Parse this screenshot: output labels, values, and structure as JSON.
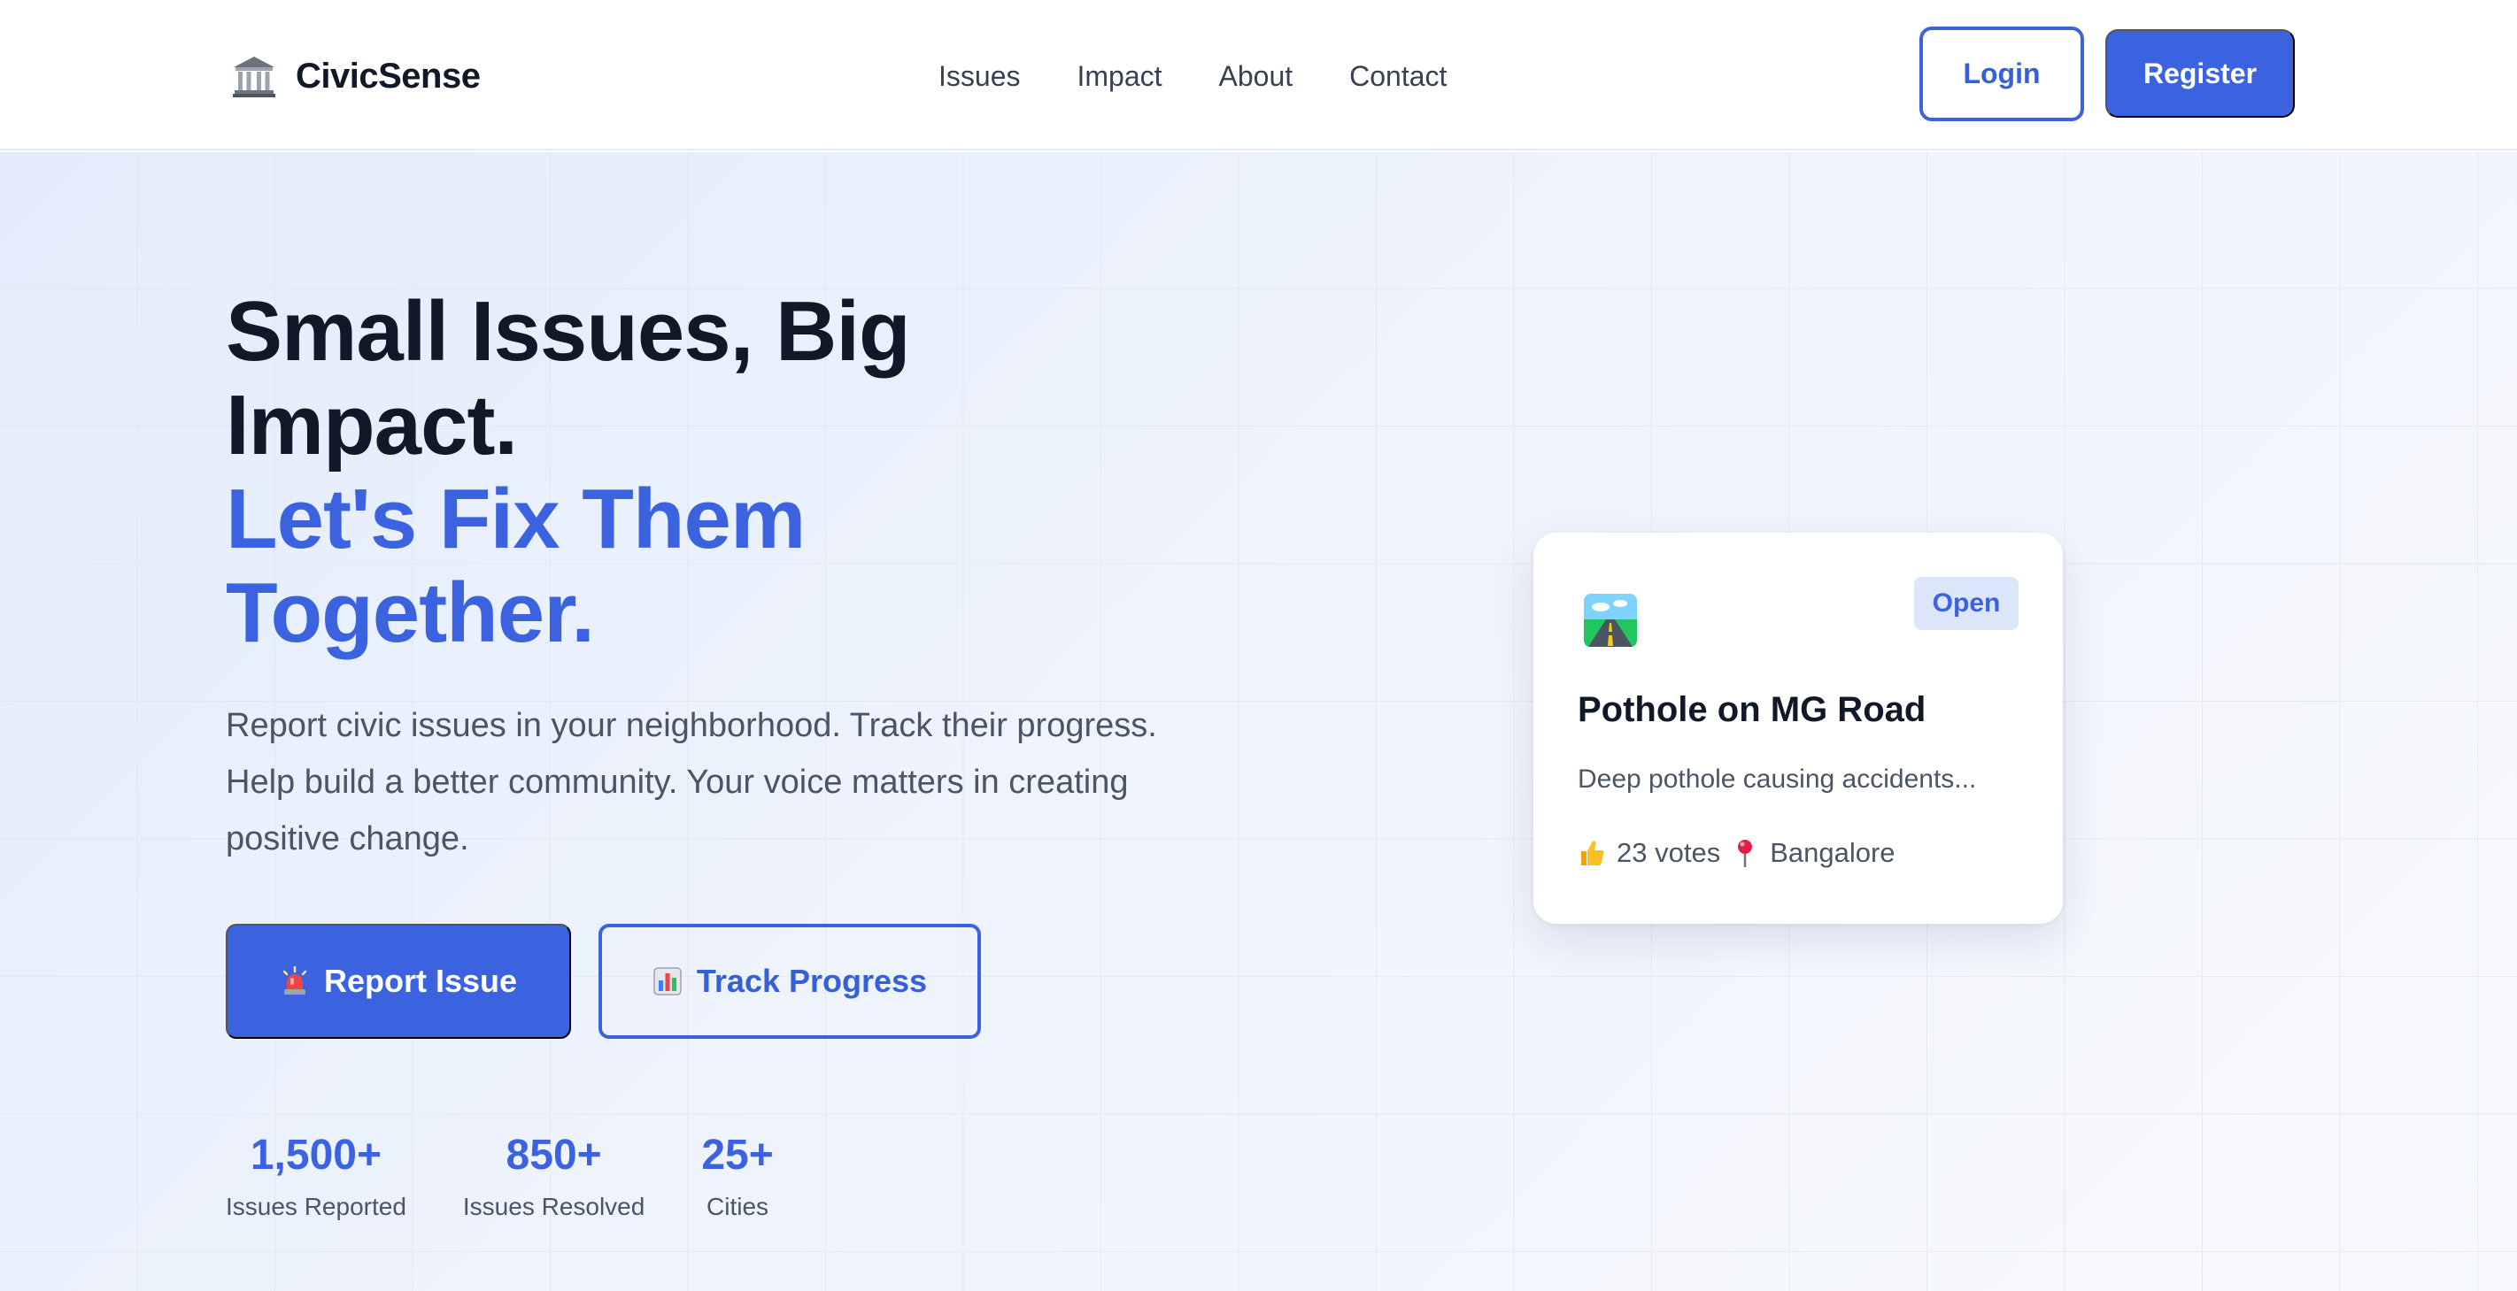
{
  "header": {
    "brand_name": "CivicSense",
    "brand_icon": "classical-building-icon",
    "nav": [
      {
        "label": "Issues"
      },
      {
        "label": "Impact"
      },
      {
        "label": "About"
      },
      {
        "label": "Contact"
      }
    ],
    "login_label": "Login",
    "register_label": "Register"
  },
  "hero": {
    "headline_line1": "Small Issues, Big",
    "headline_line2": "Impact.",
    "headline_line3": "Let's Fix Them",
    "headline_line4": "Together.",
    "subtext": "Report civic issues in your neighborhood. Track their progress. Help build a better community. Your voice matters in creating positive change.",
    "report_button": {
      "label": "Report Issue",
      "icon": "siren-icon"
    },
    "track_button": {
      "label": "Track Progress",
      "icon": "bar-chart-icon"
    },
    "stats": [
      {
        "value": "1,500+",
        "label": "Issues Reported"
      },
      {
        "value": "850+",
        "label": "Issues Resolved"
      },
      {
        "value": "25+",
        "label": "Cities"
      }
    ]
  },
  "issue_card": {
    "icon": "road-icon",
    "status": "Open",
    "title": "Pothole on MG Road",
    "description": "Deep pothole causing accidents...",
    "votes_icon": "thumbs-up-icon",
    "votes": "23 votes",
    "location_icon": "location-pin-icon",
    "location": "Bangalore"
  },
  "colors": {
    "accent": "#3b63e0",
    "heading": "#111827",
    "body_text": "#4b5563",
    "badge_bg": "#dbe6fb"
  }
}
